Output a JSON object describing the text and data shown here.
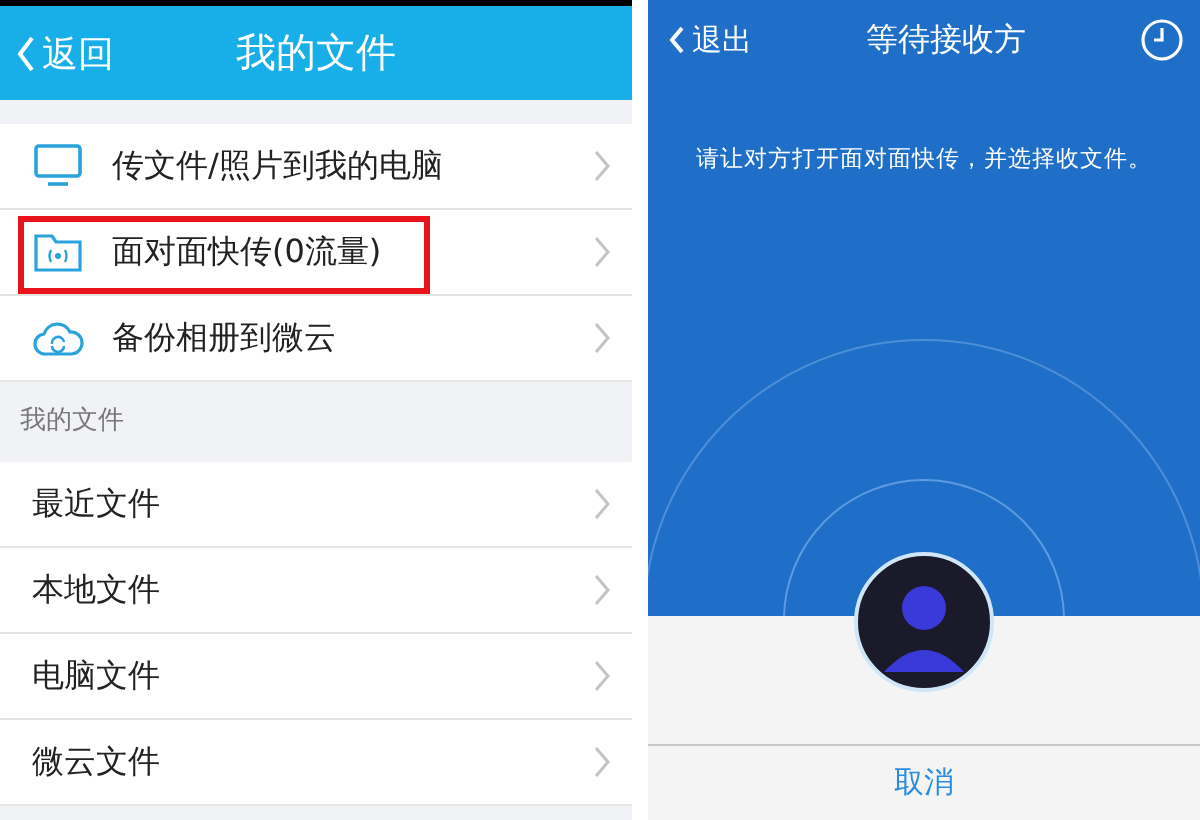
{
  "left_screen": {
    "back_button": "返回",
    "title": "我的文件",
    "actions": [
      {
        "kind": "computer",
        "label": "传文件/照片到我的电脑",
        "highlighted": false
      },
      {
        "kind": "folder",
        "label": "面对面快传(0流量)",
        "highlighted": true
      },
      {
        "kind": "cloud",
        "label": "备份相册到微云",
        "highlighted": false
      }
    ],
    "section_title": "我的文件",
    "files": [
      {
        "label": "最近文件"
      },
      {
        "label": "本地文件"
      },
      {
        "label": "电脑文件"
      },
      {
        "label": "微云文件"
      }
    ]
  },
  "right_screen": {
    "back_button": "退出",
    "title": "等待接收方",
    "message": "请让对方打开面对面快传，并选择收文件。",
    "cancel_button": "取消"
  }
}
